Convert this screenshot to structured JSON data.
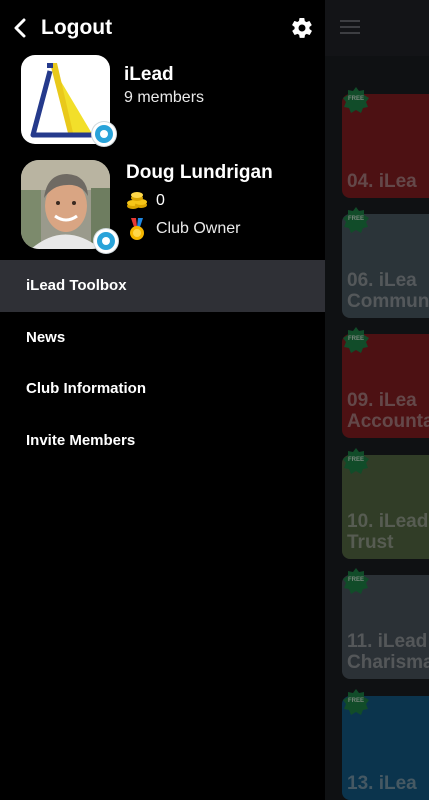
{
  "header": {
    "back_label": "Logout"
  },
  "club": {
    "name": "iLead",
    "members": "9 members"
  },
  "user": {
    "name": "Doug Lundrigan",
    "coins": "0",
    "role": "Club Owner"
  },
  "menu": {
    "items": [
      "iLead Toolbox",
      "News",
      "Club Information",
      "Invite Members"
    ],
    "active_index": 0
  },
  "background_cards": [
    {
      "title": "04. iLea",
      "badge": "FREE",
      "color": "#8d1f23"
    },
    {
      "title": "06. iLea\nCommun",
      "badge": "FREE",
      "color": "#4f5f69"
    },
    {
      "title": "09. iLea\nAccounta",
      "badge": "FREE",
      "color": "#8d1f23"
    },
    {
      "title": "10. iLead\nTrust",
      "badge": "FREE",
      "color": "#596f47"
    },
    {
      "title": "11. iLead\nCharisma",
      "badge": "FREE",
      "color": "#4f5a63"
    },
    {
      "title": "13. iLea",
      "badge": "FREE",
      "color": "#15608c"
    }
  ],
  "colors": {
    "drawer_bg": "#000000",
    "active_item_bg": "#2f3036",
    "badge_blue": "#29a3d9",
    "free_badge_green": "#1f8a4c"
  }
}
